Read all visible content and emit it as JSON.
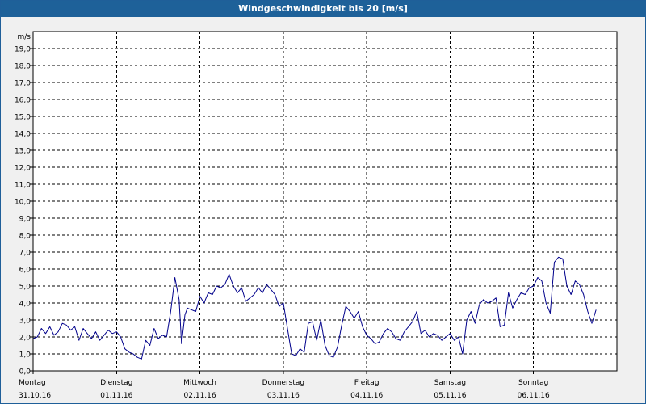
{
  "header": {
    "title": "Windgeschwindigkeit bis 20 [m/s]"
  },
  "colors": {
    "titlebar": "#1e6199",
    "line": "#00008b",
    "grid": "#000000",
    "plot_bg": "#ffffff"
  },
  "chart_data": {
    "type": "line",
    "title": "Windgeschwindigkeit bis 20 [m/s]",
    "ylabel": "m/s",
    "ylim": [
      0,
      20
    ],
    "yticks": [
      "0,0",
      "1,0",
      "2,0",
      "3,0",
      "4,0",
      "5,0",
      "6,0",
      "7,0",
      "8,0",
      "9,0",
      "10,0",
      "11,0",
      "12,0",
      "13,0",
      "14,0",
      "15,0",
      "16,0",
      "17,0",
      "18,0",
      "19,0"
    ],
    "xlim": [
      0,
      7
    ],
    "xticks": [
      {
        "x": 0,
        "day": "Montag",
        "date": "31.10.16"
      },
      {
        "x": 1,
        "day": "Dienstag",
        "date": "01.11.16"
      },
      {
        "x": 2,
        "day": "Mittwoch",
        "date": "02.11.16"
      },
      {
        "x": 3,
        "day": "Donnerstag",
        "date": "03.11.16"
      },
      {
        "x": 4,
        "day": "Freitag",
        "date": "04.11.16"
      },
      {
        "x": 5,
        "day": "Samstag",
        "date": "05.11.16"
      },
      {
        "x": 6,
        "day": "Sonntag",
        "date": "06.11.16"
      }
    ],
    "grid": true,
    "series": [
      {
        "values": [
          [
            0.0,
            1.9
          ],
          [
            0.05,
            2.0
          ],
          [
            0.1,
            2.5
          ],
          [
            0.15,
            2.2
          ],
          [
            0.2,
            2.6
          ],
          [
            0.25,
            2.1
          ],
          [
            0.3,
            2.3
          ],
          [
            0.35,
            2.8
          ],
          [
            0.4,
            2.7
          ],
          [
            0.45,
            2.4
          ],
          [
            0.5,
            2.6
          ],
          [
            0.55,
            1.8
          ],
          [
            0.6,
            2.5
          ],
          [
            0.65,
            2.2
          ],
          [
            0.7,
            1.9
          ],
          [
            0.75,
            2.3
          ],
          [
            0.8,
            1.8
          ],
          [
            0.85,
            2.1
          ],
          [
            0.9,
            2.4
          ],
          [
            0.95,
            2.2
          ],
          [
            1.0,
            2.3
          ],
          [
            1.05,
            2.0
          ],
          [
            1.1,
            1.3
          ],
          [
            1.15,
            1.1
          ],
          [
            1.2,
            1.0
          ],
          [
            1.25,
            0.8
          ],
          [
            1.3,
            0.7
          ],
          [
            1.35,
            1.8
          ],
          [
            1.4,
            1.5
          ],
          [
            1.45,
            2.5
          ],
          [
            1.5,
            1.9
          ],
          [
            1.55,
            2.1
          ],
          [
            1.6,
            2.0
          ],
          [
            1.65,
            3.5
          ],
          [
            1.7,
            5.5
          ],
          [
            1.75,
            4.2
          ],
          [
            1.78,
            1.6
          ],
          [
            1.82,
            3.3
          ],
          [
            1.85,
            3.7
          ],
          [
            1.9,
            3.6
          ],
          [
            1.95,
            3.5
          ],
          [
            2.0,
            4.4
          ],
          [
            2.05,
            4.0
          ],
          [
            2.1,
            4.6
          ],
          [
            2.15,
            4.5
          ],
          [
            2.2,
            5.0
          ],
          [
            2.25,
            4.9
          ],
          [
            2.3,
            5.1
          ],
          [
            2.35,
            5.7
          ],
          [
            2.4,
            5.0
          ],
          [
            2.45,
            4.6
          ],
          [
            2.5,
            4.9
          ],
          [
            2.55,
            4.1
          ],
          [
            2.6,
            4.3
          ],
          [
            2.65,
            4.5
          ],
          [
            2.7,
            4.9
          ],
          [
            2.75,
            4.6
          ],
          [
            2.8,
            5.1
          ],
          [
            2.85,
            4.8
          ],
          [
            2.9,
            4.5
          ],
          [
            2.95,
            3.8
          ],
          [
            3.0,
            4.0
          ],
          [
            3.05,
            2.5
          ],
          [
            3.1,
            1.0
          ],
          [
            3.15,
            0.9
          ],
          [
            3.2,
            1.3
          ],
          [
            3.25,
            1.1
          ],
          [
            3.3,
            2.8
          ],
          [
            3.35,
            2.9
          ],
          [
            3.4,
            1.8
          ],
          [
            3.45,
            3.0
          ],
          [
            3.5,
            1.5
          ],
          [
            3.55,
            0.9
          ],
          [
            3.6,
            0.8
          ],
          [
            3.65,
            1.4
          ],
          [
            3.7,
            2.7
          ],
          [
            3.75,
            3.8
          ],
          [
            3.8,
            3.5
          ],
          [
            3.85,
            3.1
          ],
          [
            3.9,
            3.5
          ],
          [
            3.95,
            2.6
          ],
          [
            4.0,
            2.1
          ],
          [
            4.05,
            1.9
          ],
          [
            4.1,
            1.6
          ],
          [
            4.15,
            1.7
          ],
          [
            4.2,
            2.2
          ],
          [
            4.25,
            2.5
          ],
          [
            4.3,
            2.3
          ],
          [
            4.35,
            1.9
          ],
          [
            4.4,
            1.8
          ],
          [
            4.45,
            2.3
          ],
          [
            4.5,
            2.6
          ],
          [
            4.55,
            2.9
          ],
          [
            4.6,
            3.5
          ],
          [
            4.65,
            2.2
          ],
          [
            4.7,
            2.4
          ],
          [
            4.75,
            2.0
          ],
          [
            4.8,
            2.2
          ],
          [
            4.85,
            2.1
          ],
          [
            4.9,
            1.8
          ],
          [
            4.95,
            2.0
          ],
          [
            5.0,
            2.2
          ],
          [
            5.05,
            1.8
          ],
          [
            5.1,
            2.0
          ],
          [
            5.15,
            1.0
          ],
          [
            5.2,
            3.0
          ],
          [
            5.25,
            3.5
          ],
          [
            5.3,
            2.8
          ],
          [
            5.35,
            3.9
          ],
          [
            5.4,
            4.2
          ],
          [
            5.45,
            4.0
          ],
          [
            5.5,
            4.1
          ],
          [
            5.55,
            4.3
          ],
          [
            5.6,
            2.6
          ],
          [
            5.65,
            2.7
          ],
          [
            5.7,
            4.6
          ],
          [
            5.75,
            3.7
          ],
          [
            5.8,
            4.2
          ],
          [
            5.85,
            4.6
          ],
          [
            5.9,
            4.5
          ],
          [
            5.95,
            4.9
          ],
          [
            6.0,
            5.0
          ],
          [
            6.05,
            5.5
          ],
          [
            6.1,
            5.3
          ],
          [
            6.15,
            4.0
          ],
          [
            6.2,
            3.4
          ],
          [
            6.25,
            6.4
          ],
          [
            6.3,
            6.7
          ],
          [
            6.35,
            6.6
          ],
          [
            6.4,
            5.0
          ],
          [
            6.45,
            4.5
          ],
          [
            6.5,
            5.3
          ],
          [
            6.55,
            5.1
          ],
          [
            6.6,
            4.5
          ],
          [
            6.65,
            3.5
          ],
          [
            6.7,
            2.8
          ],
          [
            6.75,
            3.6
          ]
        ]
      }
    ]
  }
}
